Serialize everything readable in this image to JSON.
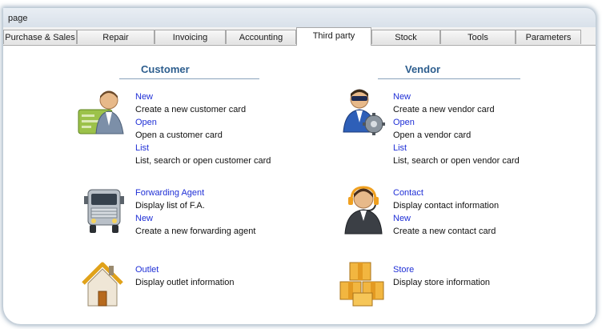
{
  "window": {
    "title": "page"
  },
  "tabs": [
    {
      "label": "Purchase & Sales"
    },
    {
      "label": "Repair"
    },
    {
      "label": "Invoicing"
    },
    {
      "label": "Accounting"
    },
    {
      "label": "Third party",
      "active": true
    },
    {
      "label": "Stock"
    },
    {
      "label": "Tools"
    },
    {
      "label": "Parameters"
    }
  ],
  "customer": {
    "heading": "Customer",
    "new_link": "New",
    "new_desc": "Create a new customer card",
    "open_link": "Open",
    "open_desc": "Open a customer card",
    "list_link": "List",
    "list_desc": "List, search or open customer card"
  },
  "vendor": {
    "heading": "Vendor",
    "new_link": "New",
    "new_desc": "Create a new vendor card",
    "open_link": "Open",
    "open_desc": "Open a vendor card",
    "list_link": "List",
    "list_desc": "List, search or open vendor card"
  },
  "forwarding_agent": {
    "link": "Forwarding Agent",
    "desc": "Display list of F.A.",
    "new_link": "New",
    "new_desc": "Create a new forwarding agent"
  },
  "contact": {
    "link": "Contact",
    "desc": "Display contact information",
    "new_link": "New",
    "new_desc": "Create a new contact card"
  },
  "outlet": {
    "link": "Outlet",
    "desc": "Display outlet information"
  },
  "store": {
    "link": "Store",
    "desc": "Display store information"
  },
  "icons": {
    "customer": "customer-person-card-icon",
    "vendor": "vendor-person-gear-icon",
    "forwarding_agent": "truck-icon",
    "contact": "headset-agent-icon",
    "outlet": "house-icon",
    "store": "boxes-icon"
  },
  "colors": {
    "link": "#1f2fd6",
    "heading": "#2d5e8e"
  }
}
